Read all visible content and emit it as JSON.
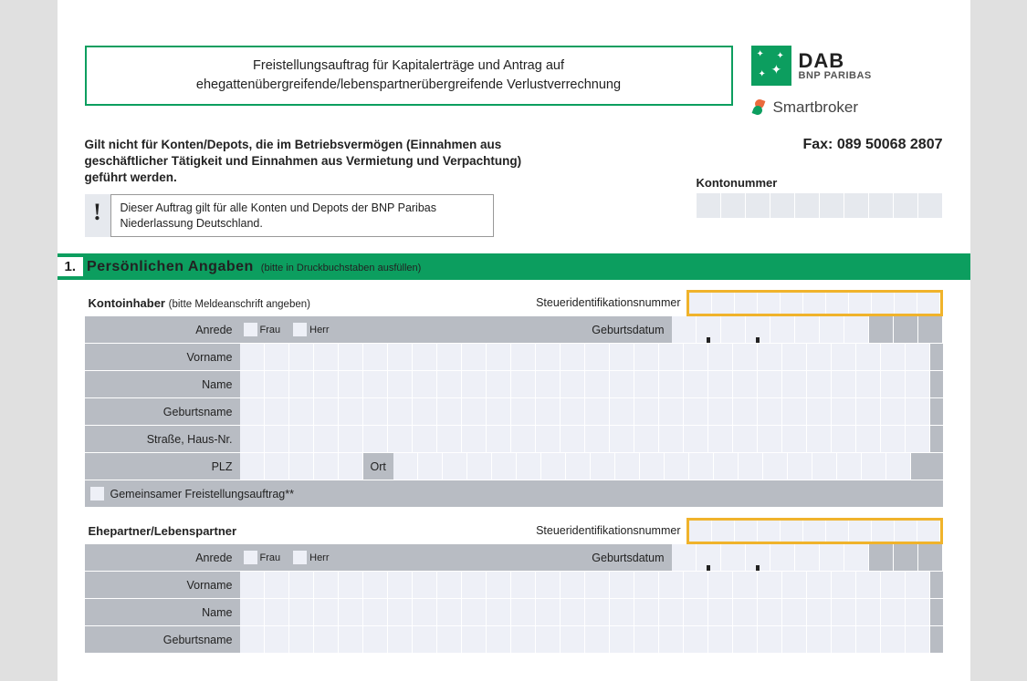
{
  "title_line1": "Freistellungsauftrag für Kapitalerträge und Antrag auf",
  "title_line2": "ehegattenübergreifende/lebenspartnerübergreifende Verlustverrechnung",
  "brand": {
    "name": "DAB",
    "sub": "BNP PARIBAS"
  },
  "smartbroker": "Smartbroker",
  "fax": "Fax: 089 50068 2807",
  "warn_l1": "Gilt nicht für Konten/Depots, die im Betriebsvermögen (Einnahmen aus",
  "warn_l2": "geschäftlicher Tätigkeit und Einnahmen aus Vermietung und Verpachtung)",
  "warn_l3": "geführt werden.",
  "notice_l1": "Dieser Auftrag gilt für alle Konten und Depots der BNP Paribas",
  "notice_l2": "Niederlassung Deutschland.",
  "kontonummer": "Kontonummer",
  "section": {
    "num": "1.",
    "title": "Persönlichen Angaben",
    "hint": "(bitte in Druckbuchstaben ausfüllen)"
  },
  "kontoinhaber": "Kontoinhaber",
  "kontoinhaber_hint": "(bitte Meldeanschrift angeben)",
  "tax_id": "Steueridentifikationsnummer",
  "anrede": "Anrede",
  "frau": "Frau",
  "herr": "Herr",
  "geburtsdatum": "Geburtsdatum",
  "vorname": "Vorname",
  "name": "Name",
  "geburtsname": "Geburtsname",
  "strasse": "Straße, Haus-Nr.",
  "plz": "PLZ",
  "ort": "Ort",
  "joint": "Gemeinsamer Freistellungsauftrag**",
  "ehepartner": "Ehepartner/Lebenspartner"
}
